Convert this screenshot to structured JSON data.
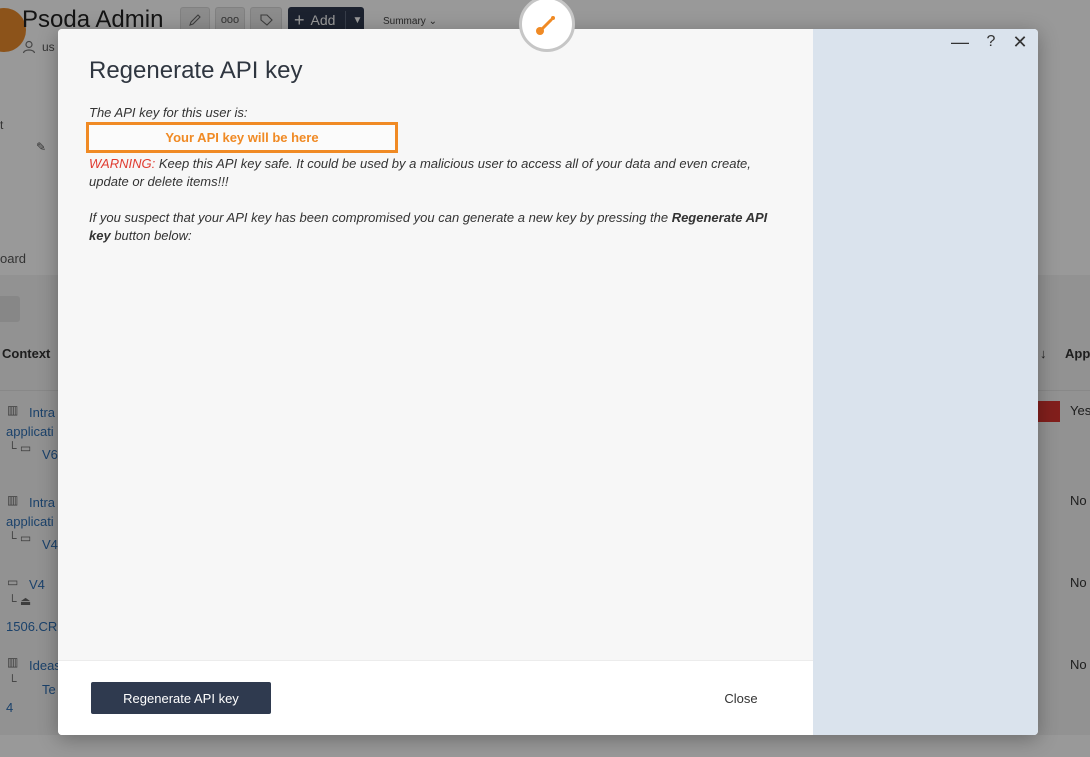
{
  "background": {
    "app_title": "Psoda Admin",
    "user_label": "us",
    "add_label": "Add",
    "summary_label": "Summary",
    "dashboard_label": "oard",
    "side_letter": "t",
    "columns": {
      "context": "Context",
      "app": "App"
    },
    "rows": [
      {
        "line1": "Intra",
        "line2": "applicati",
        "line3": "V6",
        "value": "Yes"
      },
      {
        "line1": "Intra",
        "line2": "applicati",
        "line3": "V4",
        "value": "No"
      },
      {
        "line1": "V4",
        "line2": "",
        "line3": "1506.CR",
        "value": "No"
      },
      {
        "line1": "Ideas",
        "line2": "Te",
        "line3": "4",
        "value": "No"
      }
    ]
  },
  "modal": {
    "title": "Regenerate API key",
    "intro": "The API key for this user is:",
    "api_key_placeholder": "Your API key will be here",
    "warning_label": "WARNING:",
    "warning_text": " Keep this API key safe. It could be used by a malicious user to access all of your data and even create, update or delete items!!!",
    "suspect_text_before": "If you suspect that your API key has been compromised you can generate a new key by pressing the ",
    "suspect_bold": "Regenerate API key",
    "suspect_text_after": " button below:",
    "regenerate_button": "Regenerate API key",
    "close_button": "Close",
    "controls": {
      "minimize": "—",
      "help": "?",
      "close": "✕"
    }
  },
  "colors": {
    "accent_orange": "#f08a24",
    "warning_red": "#e03c31",
    "button_dark": "#2f3a4f",
    "side_panel": "#dae3ed"
  },
  "icons": {
    "logo": "wrench-key-icon",
    "edit": "pencil-icon",
    "more": "ellipsis-icon",
    "tag": "tag-icon",
    "user": "user-icon"
  }
}
